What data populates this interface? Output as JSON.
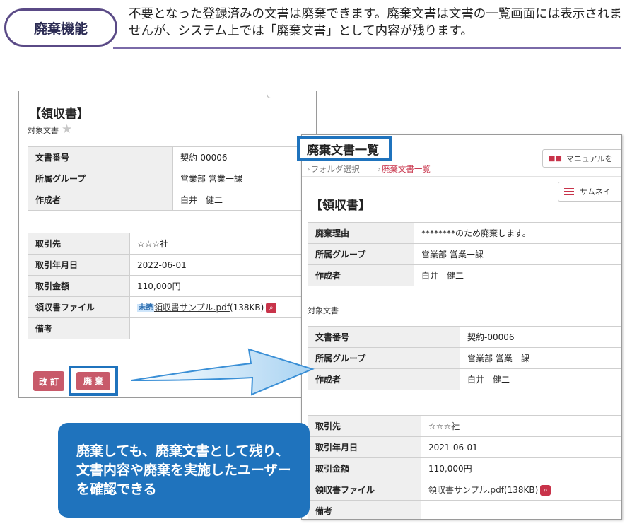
{
  "header": {
    "feature_label": "廃棄機能",
    "description": "不要となった登録済みの文書は廃棄できます。廃棄文書は文書の一覧画面には表示されませんが、システム上では「廃棄文書」として内容が残ります。"
  },
  "left_panel": {
    "title": "【領収書】",
    "target_label": "対象文書",
    "doc_fields": [
      {
        "label": "文書番号",
        "value": "契約-00006"
      },
      {
        "label": "所属グループ",
        "value": "営業部 営業一課"
      },
      {
        "label": "作成者",
        "value": "白井　健二"
      }
    ],
    "detail_fields": [
      {
        "label": "取引先",
        "value": "☆☆☆社"
      },
      {
        "label": "取引年月日",
        "value": "2022-06-01"
      },
      {
        "label": "取引金額",
        "value": "110,000円"
      },
      {
        "label": "領収書ファイル",
        "value": "領収書サンプル.pdf",
        "suffix": "(138KB)",
        "badge": "未読"
      },
      {
        "label": "備考",
        "value": ""
      }
    ],
    "revise_button": "改訂",
    "discard_button": "廃棄"
  },
  "right_panel": {
    "title": "廃棄文書一覧",
    "breadcrumb": [
      "フォルダ選択",
      "廃棄文書一覧"
    ],
    "manual_button": "マニュアルを",
    "thumbnail_button": "サムネイ",
    "doc_title": "【領収書】",
    "discard_fields": [
      {
        "label": "廃棄理由",
        "value": "********のため廃棄します。"
      },
      {
        "label": "所属グループ",
        "value": "営業部 営業一課"
      },
      {
        "label": "作成者",
        "value": "白井　健二"
      }
    ],
    "target_label": "対象文書",
    "doc_fields": [
      {
        "label": "文書番号",
        "value": "契約-00006"
      },
      {
        "label": "所属グループ",
        "value": "営業部 営業一課"
      },
      {
        "label": "作成者",
        "value": "白井　健二"
      }
    ],
    "detail_fields": [
      {
        "label": "取引先",
        "value": "☆☆☆社"
      },
      {
        "label": "取引年月日",
        "value": "2021-06-01"
      },
      {
        "label": "取引金額",
        "value": "110,000円"
      },
      {
        "label": "領収書ファイル",
        "value": "領収書サンプル.pdf",
        "suffix": "(138KB)"
      },
      {
        "label": "備考",
        "value": ""
      }
    ]
  },
  "callout": {
    "text": "廃棄しても、廃棄文書として残り、文書内容や廃棄を実施したユーザーを確認できる"
  },
  "colors": {
    "accent_purple": "#5a4a86",
    "highlight_blue": "#1f73bd",
    "button_red": "#c85a6a",
    "breadcrumb_red": "#c8334a"
  },
  "icons": [
    "star-icon",
    "zoom-icon",
    "book-icon",
    "list-icon",
    "arrow-right-icon"
  ]
}
